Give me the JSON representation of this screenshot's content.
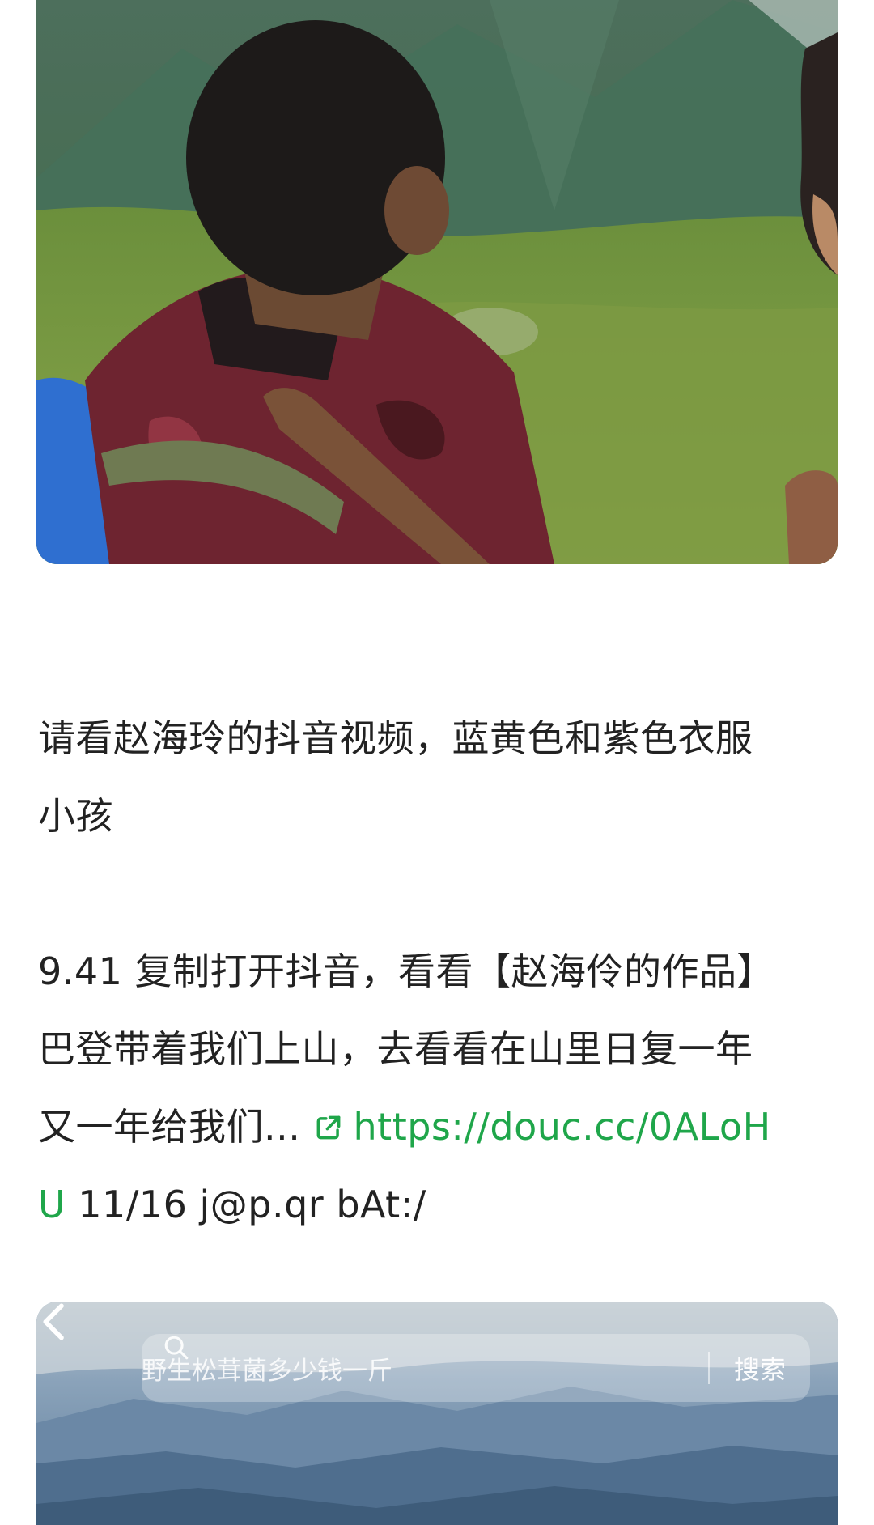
{
  "post": {
    "paragraph1": {
      "line1": "请看赵海玲的抖音视频，蓝黄色和紫色衣服",
      "line2": "小孩"
    },
    "paragraph2": {
      "line1": "9.41 复制打开抖音，看看【赵海伶的作品】",
      "line2": "巴登带着我们上山，去看看在山里日复一年",
      "line3_text": "又一年给我们...",
      "link_part1": "https://douc.cc/0ALoH",
      "link_part2": "U",
      "line4_rest": " 11/16 j@p.qr bAt:/"
    },
    "link_color": "#1fa64a",
    "link_icon": "external-link-icon"
  },
  "embedded_screenshot": {
    "search_placeholder": "野生松茸菌多少钱一斤",
    "search_button": "搜索",
    "back_icon": "chevron-left-icon",
    "search_icon": "magnifier-icon"
  }
}
